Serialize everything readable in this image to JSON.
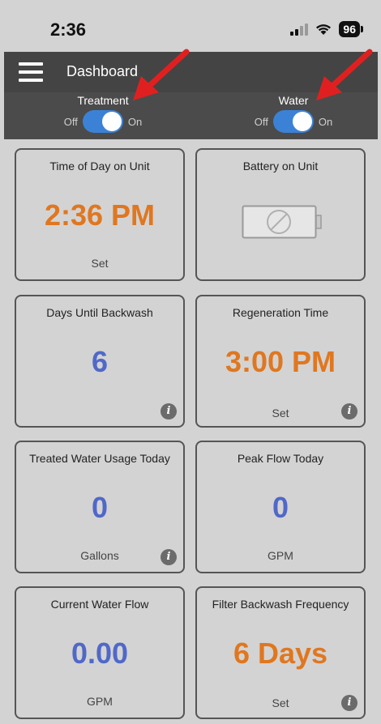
{
  "status_bar": {
    "time": "2:36",
    "battery_level": "96",
    "icons": [
      "signal-icon",
      "wifi-icon",
      "battery-icon"
    ]
  },
  "header": {
    "title": "Dashboard",
    "menu_icon": "hamburger-menu-icon"
  },
  "toggles": [
    {
      "label": "Treatment",
      "off_label": "Off",
      "on_label": "On",
      "state": "on"
    },
    {
      "label": "Water",
      "off_label": "Off",
      "on_label": "On",
      "state": "on"
    }
  ],
  "tiles": {
    "time_of_day": {
      "title": "Time of Day on Unit",
      "value": "2:36 PM",
      "action": "Set"
    },
    "battery": {
      "title": "Battery on Unit",
      "icon": "battery-unavailable-icon"
    },
    "days_until_backwash": {
      "title": "Days Until Backwash",
      "value": "6"
    },
    "regeneration_time": {
      "title": "Regeneration Time",
      "value": "3:00 PM",
      "action": "Set"
    },
    "treated_water_usage": {
      "title": "Treated Water Usage Today",
      "value": "0",
      "unit": "Gallons"
    },
    "peak_flow": {
      "title": "Peak Flow Today",
      "value": "0",
      "unit": "GPM"
    },
    "current_water_flow": {
      "title": "Current Water Flow",
      "value": "0.00",
      "unit": "GPM"
    },
    "filter_backwash_frequency": {
      "title": "Filter Backwash Frequency",
      "value": "6 Days",
      "action": "Set"
    }
  },
  "info_glyph": "i",
  "colors": {
    "header": "#4b4b4b",
    "value_orange": "#e0771f",
    "value_blue": "#5068c8",
    "toggle_on": "#3b82d6",
    "arrow_red": "#e02020"
  }
}
